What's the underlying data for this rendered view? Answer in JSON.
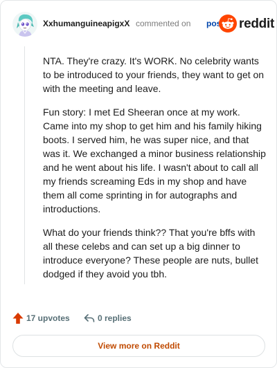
{
  "header": {
    "username": "XxhumanguineapigxX",
    "action": "commented on",
    "post_link": "post",
    "brand": "reddit",
    "brand_color": "#ff4500"
  },
  "comment": {
    "paragraphs": [
      "NTA. They're crazy. It's WORK. No celebrity wants to be introduced to your friends, they want to get on with the meeting and leave.",
      "Fun story: I met Ed Sheeran once at my work. Came into my shop to get him and his family hiking boots. I served him, he was super nice, and that was it. We exchanged a minor business relationship and he went about his life. I wasn't about to call all my friends screaming Eds in my shop and have them all come sprinting in for autographs and introductions.",
      "What do your friends think?? That you're bffs with all these celebs and can set up a big dinner to introduce everyone? These people are nuts, bullet dodged if they avoid you tbh."
    ]
  },
  "footer": {
    "upvotes": "17 upvotes",
    "replies": "0 replies",
    "upvote_icon": "upvote-arrow-icon",
    "reply_icon": "reply-arrow-icon",
    "upvote_color": "#d93a00"
  },
  "view_more": {
    "label": "View more on Reddit",
    "color": "#c04a00"
  }
}
